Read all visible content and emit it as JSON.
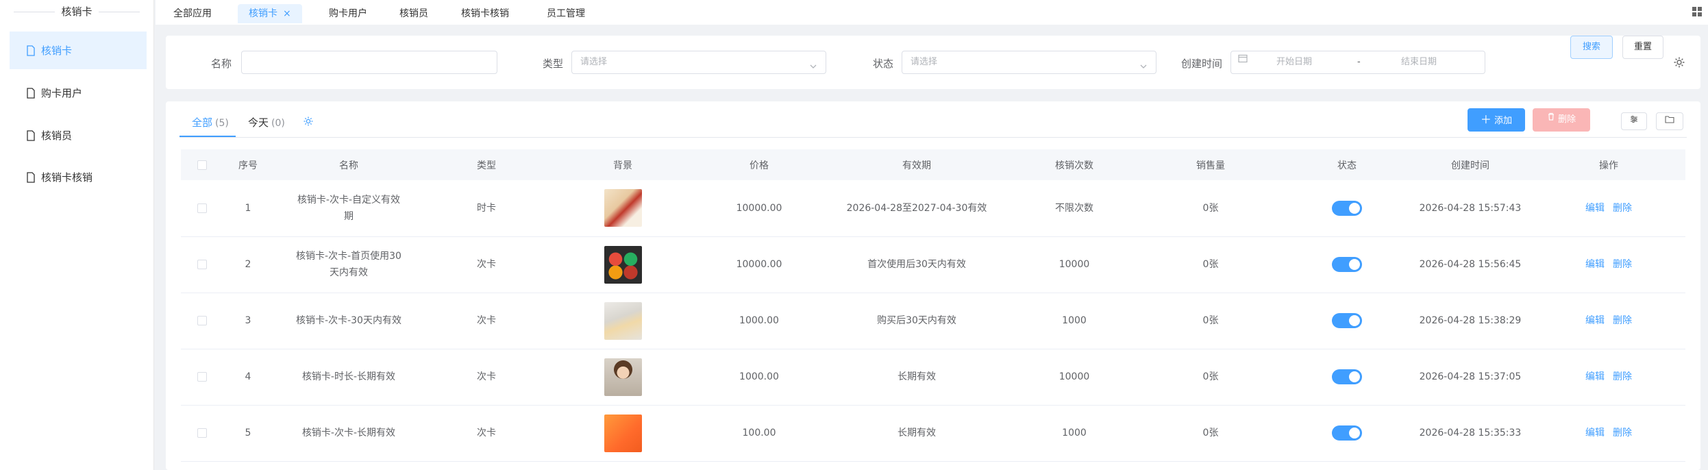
{
  "sidebar": {
    "title": "核销卡",
    "items": [
      {
        "label": "核销卡",
        "active": true
      },
      {
        "label": "购卡用户",
        "active": false
      },
      {
        "label": "核销员",
        "active": false
      },
      {
        "label": "核销卡核销",
        "active": false
      }
    ]
  },
  "tabs": [
    {
      "label": "全部应用"
    },
    {
      "label": "核销卡",
      "active": true,
      "close": "×"
    },
    {
      "label": "购卡用户"
    },
    {
      "label": "核销员"
    },
    {
      "label": "核销卡核销"
    },
    {
      "label": "员工管理"
    }
  ],
  "filter": {
    "name_label": "名称",
    "name_value": "",
    "type_label": "类型",
    "type_placeholder": "请选择",
    "status_label": "状态",
    "status_placeholder": "请选择",
    "created_label": "创建时间",
    "start_placeholder": "开始日期",
    "range_sep": "-",
    "end_placeholder": "结束日期",
    "search_button": "搜索",
    "reset_button": "重置"
  },
  "list": {
    "tabs": [
      {
        "label": "全部",
        "count": "(5)",
        "active": true
      },
      {
        "label": "今天",
        "count": "(0)"
      }
    ],
    "add_button": "添加",
    "delete_button": "删除"
  },
  "table": {
    "headers": [
      "",
      "序号",
      "名称",
      "类型",
      "背景",
      "价格",
      "有效期",
      "核销次数",
      "销售量",
      "状态",
      "创建时间",
      "操作"
    ],
    "rows": [
      {
        "no": "1",
        "name": "核销卡-次卡-自定义有效期",
        "type": "时卡",
        "price": "10000.00",
        "validity": "2026-04-28至2027-04-30有效",
        "times": "不限次数",
        "sales": "0张",
        "enabled": true,
        "created": "2026-04-28 15:57:43",
        "bg": "thumb-1"
      },
      {
        "no": "2",
        "name": "核销卡-次卡-首页使用30天内有效",
        "type": "次卡",
        "price": "10000.00",
        "validity": "首次使用后30天内有效",
        "times": "10000",
        "sales": "0张",
        "enabled": true,
        "created": "2026-04-28 15:56:45",
        "bg": "thumb-2"
      },
      {
        "no": "3",
        "name": "核销卡-次卡-30天内有效",
        "type": "次卡",
        "price": "1000.00",
        "validity": "购买后30天内有效",
        "times": "1000",
        "sales": "0张",
        "enabled": true,
        "created": "2026-04-28 15:38:29",
        "bg": "thumb-3"
      },
      {
        "no": "4",
        "name": "核销卡-时长-长期有效",
        "type": "次卡",
        "price": "1000.00",
        "validity": "长期有效",
        "times": "10000",
        "sales": "0张",
        "enabled": true,
        "created": "2026-04-28 15:37:05",
        "bg": "thumb-4"
      },
      {
        "no": "5",
        "name": "核销卡-次卡-长期有效",
        "type": "次卡",
        "price": "100.00",
        "validity": "长期有效",
        "times": "1000",
        "sales": "0张",
        "enabled": true,
        "created": "2026-04-28 15:35:33",
        "bg": "thumb-5"
      }
    ],
    "edit_label": "编辑",
    "delete_label": "删除"
  },
  "colors": {
    "primary": "#409eff",
    "danger_light": "#fab6b6",
    "row_divider": "#ebeef5"
  }
}
